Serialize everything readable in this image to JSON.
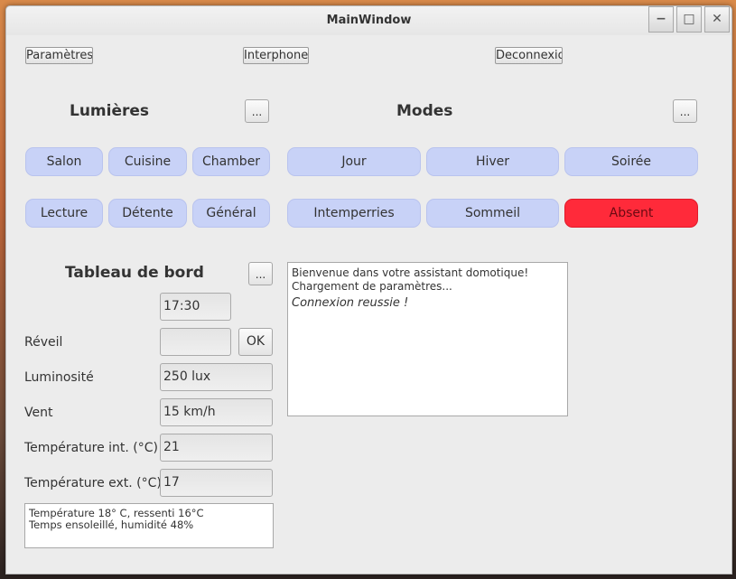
{
  "window": {
    "title": "MainWindow",
    "controls": {
      "minimize": "−",
      "maximize": "□",
      "close": "✕"
    }
  },
  "toolbar": {
    "parametres": "Paramètres",
    "interphone": "Interphone",
    "deconnexion": "Deconnexion"
  },
  "lumieres": {
    "title": "Lumières",
    "more": "...",
    "buttons": [
      "Salon",
      "Cuisine",
      "Chamber",
      "Lecture",
      "Détente",
      "Général"
    ]
  },
  "modes": {
    "title": "Modes",
    "more": "...",
    "buttons": [
      "Jour",
      "Hiver",
      "Soirée",
      "Intemperries",
      "Sommeil",
      "Absent"
    ],
    "active": "Absent",
    "active_color": "#ff2a3a",
    "inactive_color": "#c8d2f7"
  },
  "dashboard": {
    "title": "Tableau de bord",
    "more": "...",
    "time": "17:30",
    "reveil": {
      "label": "Réveil",
      "value": "",
      "ok": "OK"
    },
    "luminosite": {
      "label": "Luminosité",
      "value": "250 lux"
    },
    "vent": {
      "label": "Vent",
      "value": "15 km/h"
    },
    "temp_int": {
      "label": "Température int. (°C)",
      "value": "21"
    },
    "temp_ext": {
      "label": "Température ext. (°C)",
      "value": "17"
    },
    "weather": [
      "Température 18° C, ressenti 16°C",
      "Temps ensoleillé, humidité 48%"
    ]
  },
  "log": {
    "lines": [
      "Bienvenue dans votre assistant domotique!",
      "Chargement de paramètres..."
    ],
    "status": "Connexion reussie !"
  }
}
